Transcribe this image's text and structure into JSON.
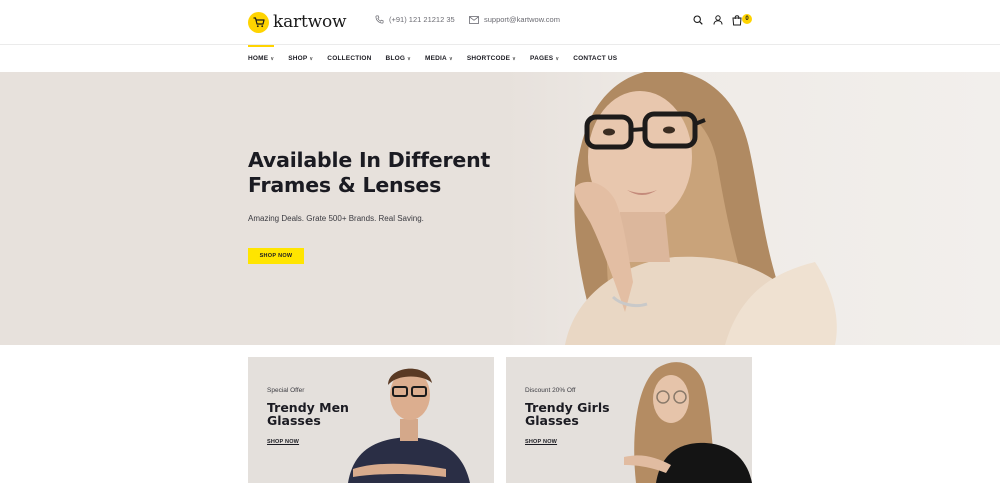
{
  "brand": {
    "name": "kartwow",
    "accent": "#ffd400"
  },
  "contact": {
    "phone": "(+91) 121 21212 35",
    "email": "support@kartwow.com"
  },
  "header_icons": [
    "search-icon",
    "user-icon",
    "cart-icon"
  ],
  "cart": {
    "count": "0"
  },
  "nav": {
    "items": [
      {
        "label": "HOME",
        "dropdown": true
      },
      {
        "label": "SHOP",
        "dropdown": true
      },
      {
        "label": "COLLECTION",
        "dropdown": false
      },
      {
        "label": "BLOG",
        "dropdown": true
      },
      {
        "label": "MEDIA",
        "dropdown": true
      },
      {
        "label": "SHORTCODE",
        "dropdown": true
      },
      {
        "label": "PAGES",
        "dropdown": true
      },
      {
        "label": "CONTACT US",
        "dropdown": false
      }
    ],
    "active": "HOME"
  },
  "hero": {
    "title": "Available In Different Frames & Lenses",
    "subtitle": "Amazing Deals. Grate 500+ Brands. Real Saving.",
    "button": "SHOP NOW"
  },
  "banners": [
    {
      "tag": "Special Offer",
      "title": "Trendy Men Glasses",
      "link": "SHOP NOW"
    },
    {
      "tag": "Discount 20% Off",
      "title": "Trendy Girls Glasses",
      "link": "SHOP NOW"
    }
  ]
}
